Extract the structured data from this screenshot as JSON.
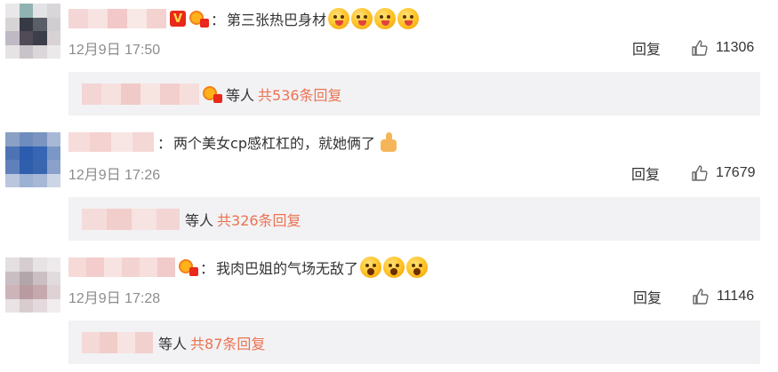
{
  "comments": [
    {
      "text": "第三张热巴身材",
      "colon": "：",
      "time": "12月9日 17:50",
      "reply_label": "回复",
      "like_count": "11306",
      "thread": {
        "suffix": "等人",
        "total": "共536条回复"
      },
      "emojis": [
        "tongue-emoji",
        "tongue-emoji",
        "tongue-emoji",
        "tongue-emoji"
      ],
      "badges": [
        "vip-v-icon",
        "fan-medal-icon"
      ]
    },
    {
      "text": "两个美女cp感杠杠的，就她俩了",
      "colon": "：",
      "time": "12月9日 17:26",
      "reply_label": "回复",
      "like_count": "17679",
      "thread": {
        "suffix": "等人",
        "total": "共326条回复"
      },
      "emojis": [
        "thumbs-up-emoji"
      ]
    },
    {
      "text": "我肉巴姐的气场无敌了",
      "colon": "：",
      "time": "12月9日 17:28",
      "reply_label": "回复",
      "like_count": "11146",
      "thread": {
        "suffix": "等人",
        "total": "共87条回复"
      },
      "emojis": [
        "shocked-emoji",
        "shocked-emoji",
        "shocked-emoji"
      ],
      "badges": [
        "fan-medal-icon"
      ]
    }
  ],
  "vip_letter": "V",
  "colors": {
    "link_orange": "#eb7350",
    "reply_bg": "#f2f2f5",
    "time_gray": "#8c8c8c",
    "text": "#333333"
  },
  "icons": {
    "like": "thumbs-up-outline-icon"
  }
}
